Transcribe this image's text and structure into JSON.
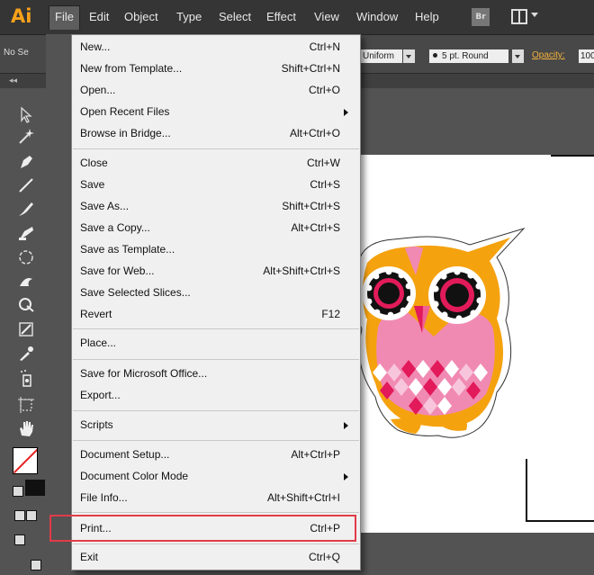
{
  "app": {
    "logo": "Ai"
  },
  "menubar": {
    "items": [
      {
        "label": "File",
        "active": true
      },
      {
        "label": "Edit"
      },
      {
        "label": "Object"
      },
      {
        "label": "Type"
      },
      {
        "label": "Select"
      },
      {
        "label": "Effect"
      },
      {
        "label": "View"
      },
      {
        "label": "Window"
      },
      {
        "label": "Help"
      }
    ],
    "bridge_badge": "Br"
  },
  "control_bar": {
    "selection": "No Se",
    "stroke_style": "Uniform",
    "brush": "5 pt. Round",
    "opacity_label": "Opacity:",
    "opacity_value": "100"
  },
  "file_menu": {
    "items": [
      {
        "label": "New...",
        "shortcut": "Ctrl+N"
      },
      {
        "label": "New from Template...",
        "shortcut": "Shift+Ctrl+N"
      },
      {
        "label": "Open...",
        "shortcut": "Ctrl+O"
      },
      {
        "label": "Open Recent Files",
        "shortcut": "",
        "submenu": true
      },
      {
        "label": "Browse in Bridge...",
        "shortcut": "Alt+Ctrl+O"
      },
      {
        "label": "Close",
        "shortcut": "Ctrl+W"
      },
      {
        "label": "Save",
        "shortcut": "Ctrl+S"
      },
      {
        "label": "Save As...",
        "shortcut": "Shift+Ctrl+S"
      },
      {
        "label": "Save a Copy...",
        "shortcut": "Alt+Ctrl+S"
      },
      {
        "label": "Save as Template...",
        "shortcut": ""
      },
      {
        "label": "Save for Web...",
        "shortcut": "Alt+Shift+Ctrl+S"
      },
      {
        "label": "Save Selected Slices...",
        "shortcut": ""
      },
      {
        "label": "Revert",
        "shortcut": "F12"
      },
      {
        "label": "Place...",
        "shortcut": ""
      },
      {
        "label": "Save for Microsoft Office...",
        "shortcut": ""
      },
      {
        "label": "Export...",
        "shortcut": ""
      },
      {
        "label": "Scripts",
        "shortcut": "",
        "submenu": true
      },
      {
        "label": "Document Setup...",
        "shortcut": "Alt+Ctrl+P"
      },
      {
        "label": "Document Color Mode",
        "shortcut": "",
        "submenu": true
      },
      {
        "label": "File Info...",
        "shortcut": "Alt+Shift+Ctrl+I"
      },
      {
        "label": "Print...",
        "shortcut": "Ctrl+P",
        "highlighted": true
      },
      {
        "label": "Exit",
        "shortcut": "Ctrl+Q"
      }
    ]
  },
  "colors": {
    "highlight_border": "#e23b48",
    "logo": "#f7a11a",
    "owl_orange": "#f5a20f",
    "owl_pink": "#f08ab3"
  },
  "tools": [
    "selection-tool",
    "magic-wand-tool",
    "pen-tool",
    "line-tool",
    "brush-tool",
    "blob-brush-tool",
    "rotate-tool",
    "warp-tool",
    "shape-builder-tool",
    "gradient-tool",
    "eyedropper-tool",
    "symbol-sprayer-tool",
    "artboard-tool",
    "hand-tool"
  ]
}
